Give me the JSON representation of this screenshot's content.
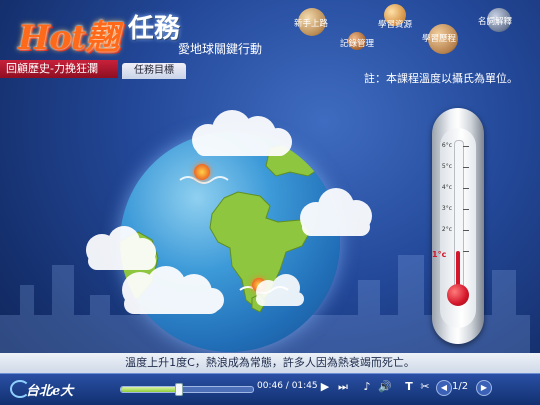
{
  "header": {
    "logo_text": "Hot",
    "logo_char": "翹",
    "task_title": "任務",
    "subtitle": "愛地球關鍵行動",
    "section": "回顧歷史-力挽狂瀾",
    "tab": "任務目標"
  },
  "menu": {
    "items": [
      {
        "label": "新手上路",
        "color": "#c9a06a"
      },
      {
        "label": "學習資源",
        "color": "#d7a55e"
      },
      {
        "label": "名詞解釋",
        "color": "#7c8aa6"
      },
      {
        "label": "記錄管理",
        "color": "#b77b4b"
      },
      {
        "label": "學習歷程",
        "color": "#c69a68"
      }
    ]
  },
  "note": "註：本課程溫度以攝氏為單位。",
  "thermometer": {
    "ticks": [
      "6°c",
      "5°c",
      "4°c",
      "3°c",
      "2°c",
      "1°c"
    ],
    "current_label": "1°c",
    "current_value": 1,
    "max_value": 6,
    "mercury_color": "#d3162a"
  },
  "caption": "溫度上升1度C，熱浪成為常態，許多人因為熱衰竭而死亡。",
  "player": {
    "brand": "台北e大",
    "time": "00:46 / 01:45",
    "progress": 0.44,
    "page": "1/2",
    "icons": [
      "play-icon",
      "next-icon",
      "music-icon",
      "volume-icon",
      "text-icon",
      "ribbon-icon",
      "prev-page-icon",
      "next-page-icon"
    ]
  }
}
